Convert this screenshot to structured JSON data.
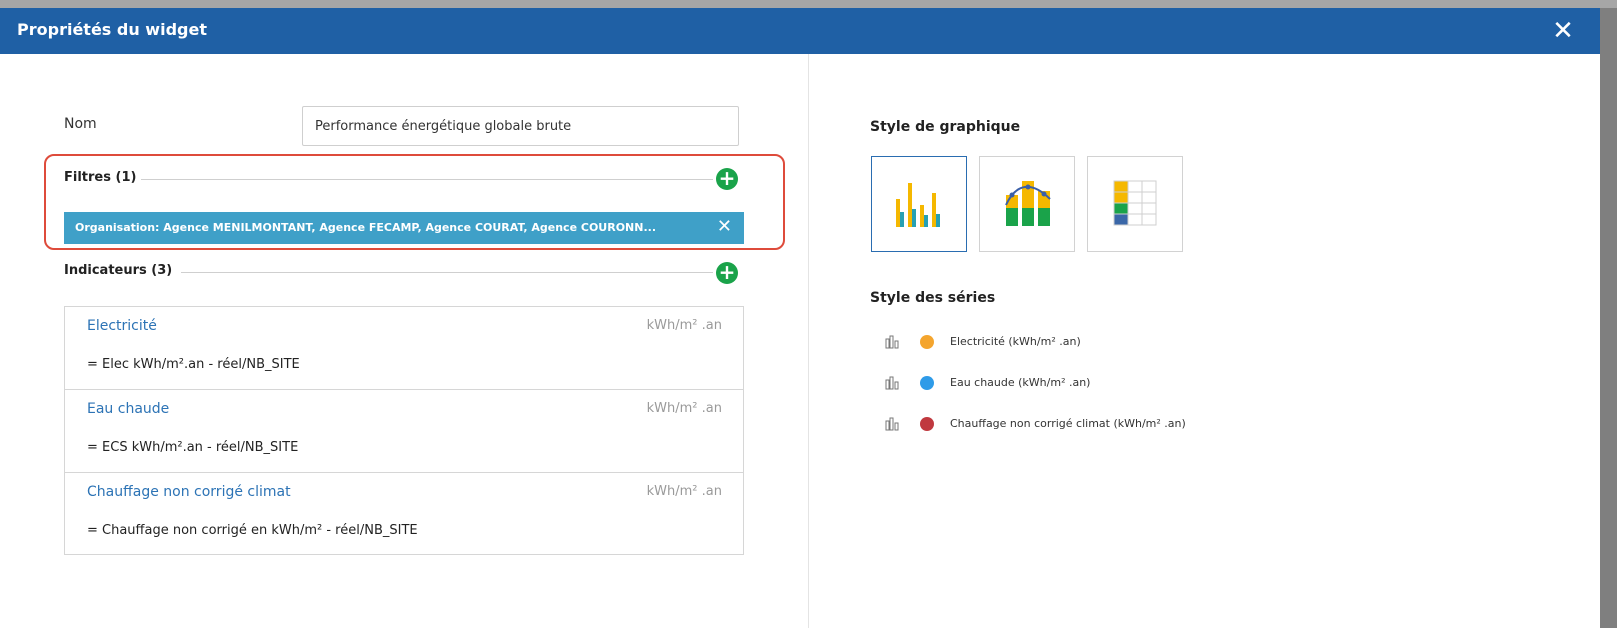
{
  "dialog": {
    "title": "Propriétés du widget",
    "close_glyph": "✕"
  },
  "name_field": {
    "label": "Nom",
    "value": "Performance énergétique globale brute"
  },
  "filters": {
    "heading": "Filtres (1)",
    "add_glyph": "+",
    "chip": {
      "text": "Organisation: Agence MENILMONTANT, Agence FECAMP, Agence COURAT, Agence COURONN...",
      "close_glyph": "✕"
    }
  },
  "indicators": {
    "heading": "Indicateurs (3)",
    "add_glyph": "+",
    "items": [
      {
        "name": "Electricité",
        "unit": "kWh/m² .an",
        "formula": "= Elec kWh/m².an - réel/NB_SITE"
      },
      {
        "name": "Eau chaude",
        "unit": "kWh/m² .an",
        "formula": "= ECS kWh/m².an - réel/NB_SITE"
      },
      {
        "name": "Chauffage non corrigé climat",
        "unit": "kWh/m² .an",
        "formula": "= Chauffage non corrigé en kWh/m² - réel/NB_SITE"
      }
    ]
  },
  "chart_style": {
    "heading": "Style de graphique",
    "options": [
      {
        "icon": "grouped-bar-chart-icon",
        "selected": true
      },
      {
        "icon": "stacked-bar-line-chart-icon",
        "selected": false
      },
      {
        "icon": "table-chart-icon",
        "selected": false
      }
    ]
  },
  "series_style": {
    "heading": "Style des séries",
    "items": [
      {
        "label": "Electricité (kWh/m² .an)",
        "color": "#f4a52e",
        "icon": "bar-chart-icon"
      },
      {
        "label": "Eau chaude (kWh/m² .an)",
        "color": "#2e9be8",
        "icon": "bar-chart-icon"
      },
      {
        "label": "Chauffage non corrigé climat (kWh/m² .an)",
        "color": "#c0393f",
        "icon": "bar-chart-icon"
      }
    ]
  },
  "colors": {
    "header": "#1f60a5",
    "chip": "#3fa0c8",
    "add": "#1aa34a",
    "highlight": "#de4b3b",
    "link": "#2c73b5"
  }
}
